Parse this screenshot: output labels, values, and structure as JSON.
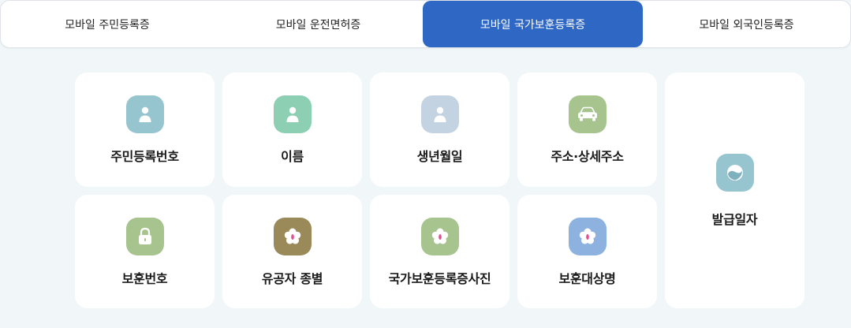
{
  "tabs": [
    {
      "label": "모바일 주민등록증",
      "active": false
    },
    {
      "label": "모바일 운전면허증",
      "active": false
    },
    {
      "label": "모바일 국가보훈등록증",
      "active": true
    },
    {
      "label": "모바일 외국인등록증",
      "active": false
    }
  ],
  "cards": [
    {
      "label": "주민등록번호",
      "icon": "person-icon",
      "color": "#96c5cf"
    },
    {
      "label": "이름",
      "icon": "person-icon",
      "color": "#8dcfb3"
    },
    {
      "label": "생년월일",
      "icon": "person-icon",
      "color": "#c4d3e1"
    },
    {
      "label": "주소·상세주소",
      "icon": "car-icon",
      "color": "#a7c48f"
    },
    {
      "label": "발급일자",
      "icon": "taegeuk-icon",
      "color": "#96c5cf"
    },
    {
      "label": "보훈번호",
      "icon": "lock-icon",
      "color": "#a7c48f"
    },
    {
      "label": "유공자 종별",
      "icon": "flower-icon",
      "color": "#9a8a5a"
    },
    {
      "label": "국가보훈등록증사진",
      "icon": "flower-icon",
      "color": "#a7c48f"
    },
    {
      "label": "보훈대상명",
      "icon": "flower-icon",
      "color": "#8db2e0"
    }
  ]
}
